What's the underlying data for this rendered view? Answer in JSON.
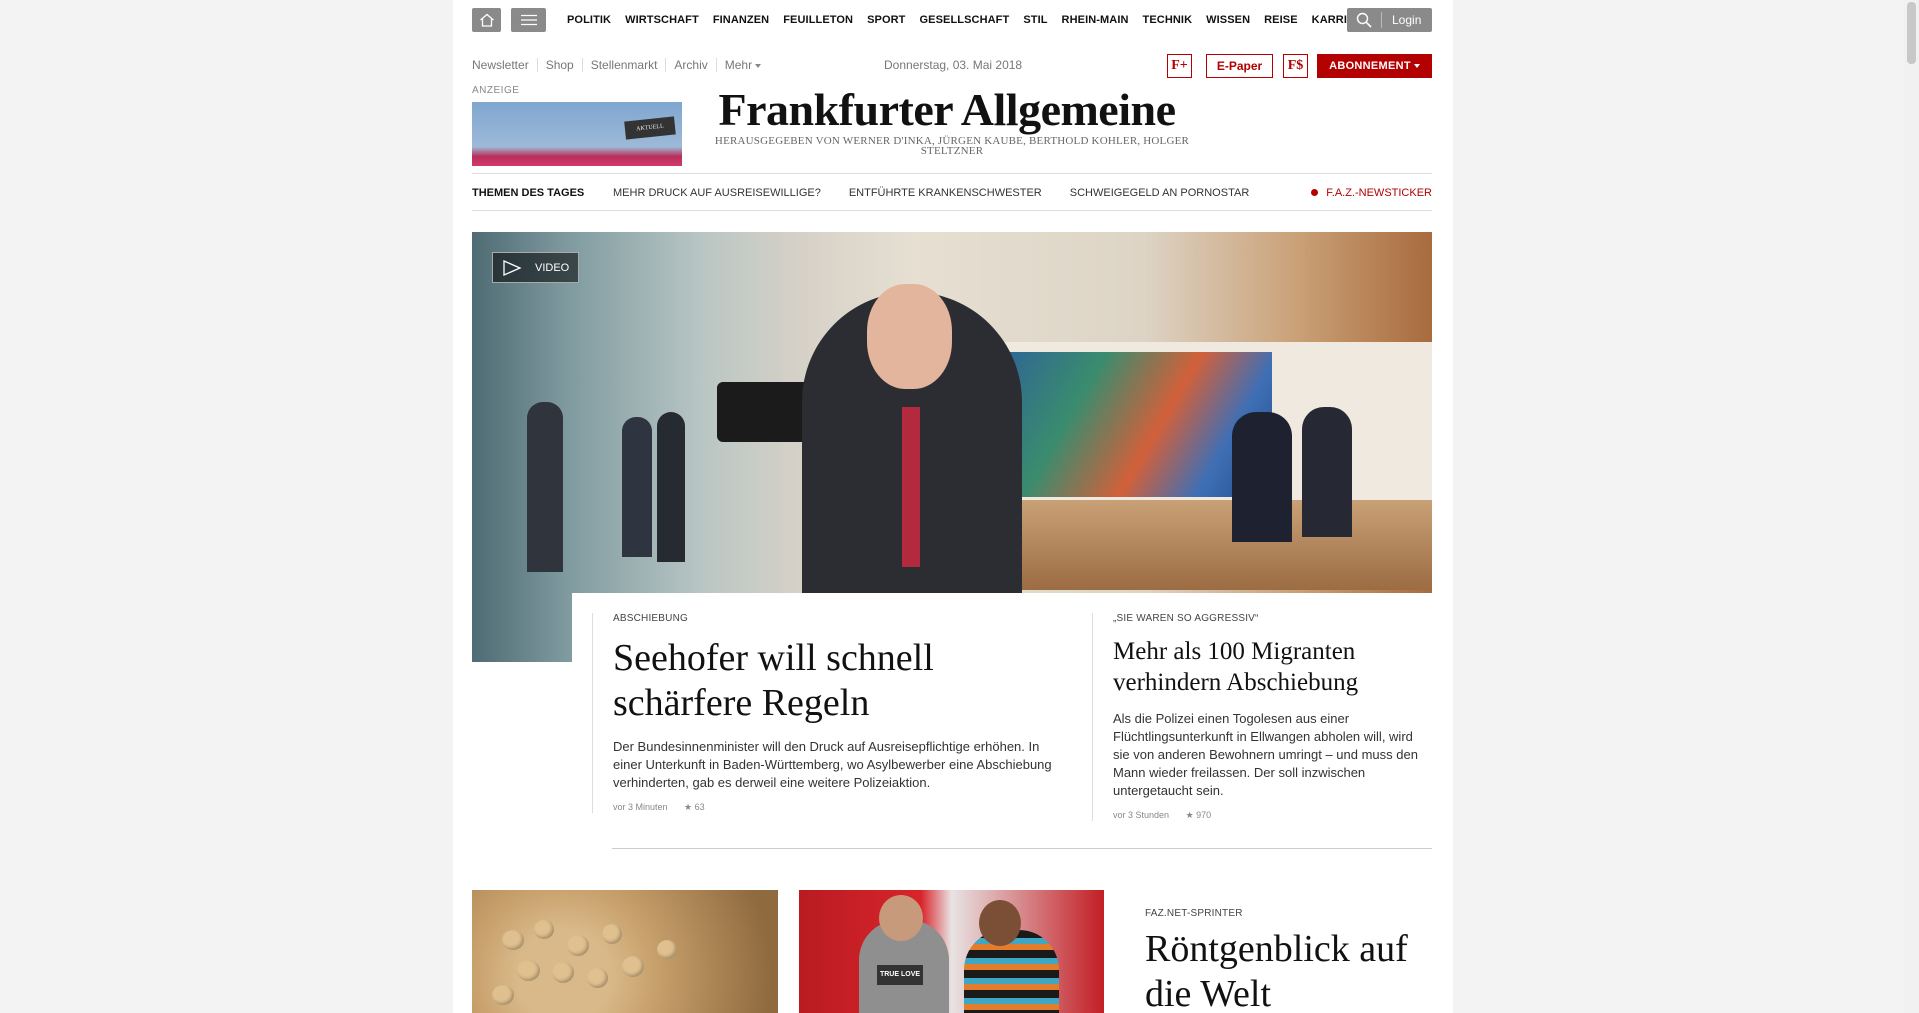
{
  "nav": {
    "items": [
      "POLITIK",
      "WIRTSCHAFT",
      "FINANZEN",
      "FEUILLETON",
      "SPORT",
      "GESELLSCHAFT",
      "STIL",
      "RHEIN-MAIN",
      "TECHNIK",
      "WISSEN",
      "REISE",
      "KARRIERE"
    ],
    "login_label": "Login"
  },
  "utility": {
    "links": [
      "Newsletter",
      "Shop",
      "Stellenmarkt",
      "Archiv",
      "Mehr"
    ],
    "date": "Donnerstag, 03. Mai 2018",
    "faz_plus_label": "F+",
    "epaper_label": "E-Paper",
    "faz_dollar_label": "F$",
    "abo_label": "ABONNEMENT"
  },
  "masthead": {
    "anzeige_label": "ANZEIGE",
    "ad_badge_text": "AKTUELL",
    "logo": "Frankfurter Allgemeine",
    "tagline": "HERAUSGEGEBEN VON WERNER D'INKA, JÜRGEN KAUBE, BERTHOLD KOHLER, HOLGER STELTZNER"
  },
  "themen": {
    "title": "THEMEN DES TAGES",
    "items": [
      "MEHR DRUCK AUF AUSREISEWILLIGE?",
      "ENTFÜHRTE KRANKENSCHWESTER",
      "SCHWEIGEGELD AN PORNOSTAR"
    ],
    "newsticker": "F.A.Z.-NEWSTICKER"
  },
  "hero": {
    "video_label": "VIDEO",
    "main": {
      "kicker": "ABSCHIEBUNG",
      "title": "Seehofer will schnell schärfere Regeln",
      "teaser": "Der Bundesinnenminister will den Druck auf Ausreisepflichtige erhöhen. In einer Unterkunft in Baden-Württemberg, wo Asylbewerber eine Abschiebung verhinderten, gab es derweil eine weitere Polizeiaktion.",
      "time": "vor 3 Minuten",
      "stars": "63"
    },
    "side": {
      "kicker": "„SIE WAREN SO AGGRESSIV“",
      "title": "Mehr als 100 Migranten verhindern Abschiebung",
      "teaser": "Als die Polizei einen Togolesen aus einer Flüchtlingsunterkunft in Ellwangen abholen will, wird sie von anderen Bewohnern umringt – und muss den Mann wieder freilassen. Der soll inzwischen untergetaucht sein.",
      "time": "vor 3 Stunden",
      "stars": "970"
    }
  },
  "bottom": {
    "thumb2_shirt_text": "TRUE LOVE",
    "sprinter_kicker": "FAZ.NET-SPRINTER",
    "sprinter_title": "Röntgenblick auf die Welt"
  },
  "colors": {
    "brand_red": "#b30000",
    "nav_gray": "#8a8a8a"
  }
}
